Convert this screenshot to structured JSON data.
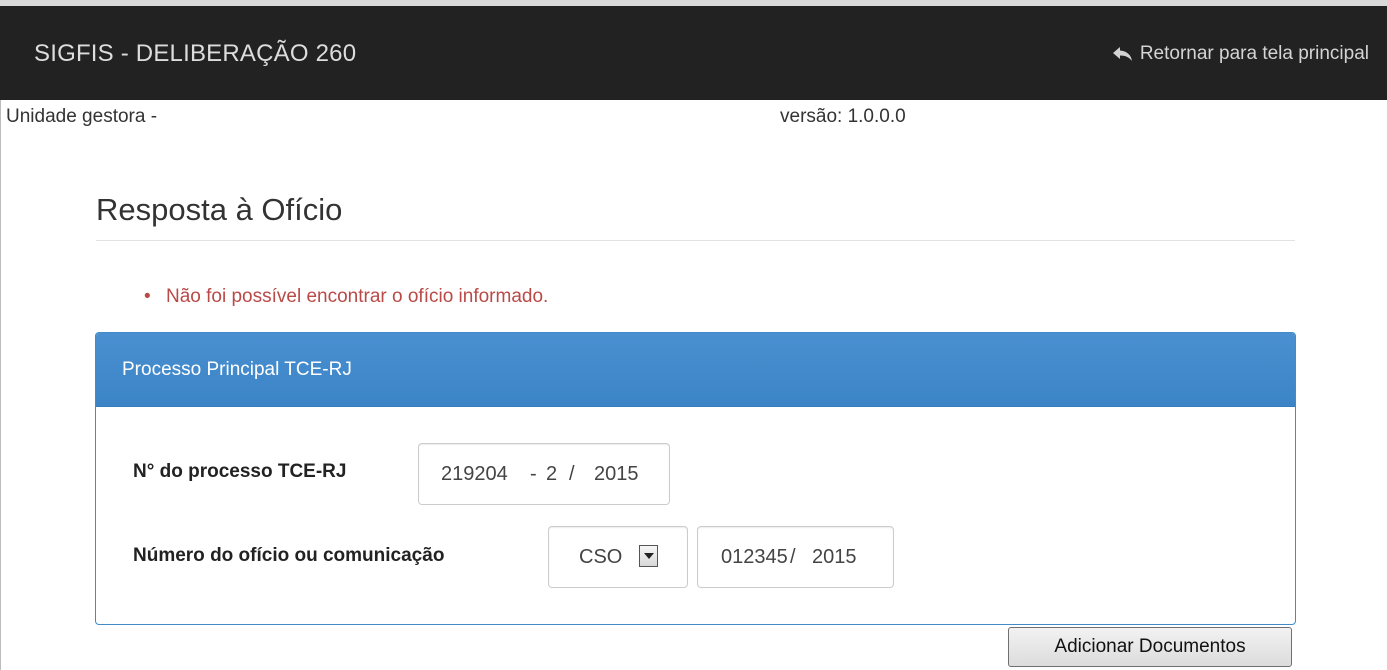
{
  "header": {
    "app_title": "SIGFIS - DELIBERAÇÃO 260",
    "return_label": "Retornar para tela principal",
    "return_icon": "reply-arrow-icon"
  },
  "subbar": {
    "unit_label": "Unidade gestora - ",
    "version_label": "versão: 1.0.0.0"
  },
  "page": {
    "title": "Resposta à Ofício"
  },
  "errors": [
    "Não foi possível encontrar o ofício informado."
  ],
  "panel": {
    "title": "Processo Principal TCE-RJ",
    "process_field": {
      "label": "N° do processo TCE-RJ",
      "number": "219204",
      "separator_dash": "-",
      "digit": "2",
      "separator_slash": "/",
      "year": "2015"
    },
    "oficio_field": {
      "label": "Número do ofício ou comunicação",
      "type_selected": "CSO",
      "number": "012345",
      "separator_slash": "/",
      "year": "2015"
    }
  },
  "actions": {
    "add_documents_label": "Adicionar Documentos"
  },
  "colors": {
    "navbar_bg": "#222222",
    "panel_primary": "#428bca",
    "error_text": "#b94a48"
  }
}
